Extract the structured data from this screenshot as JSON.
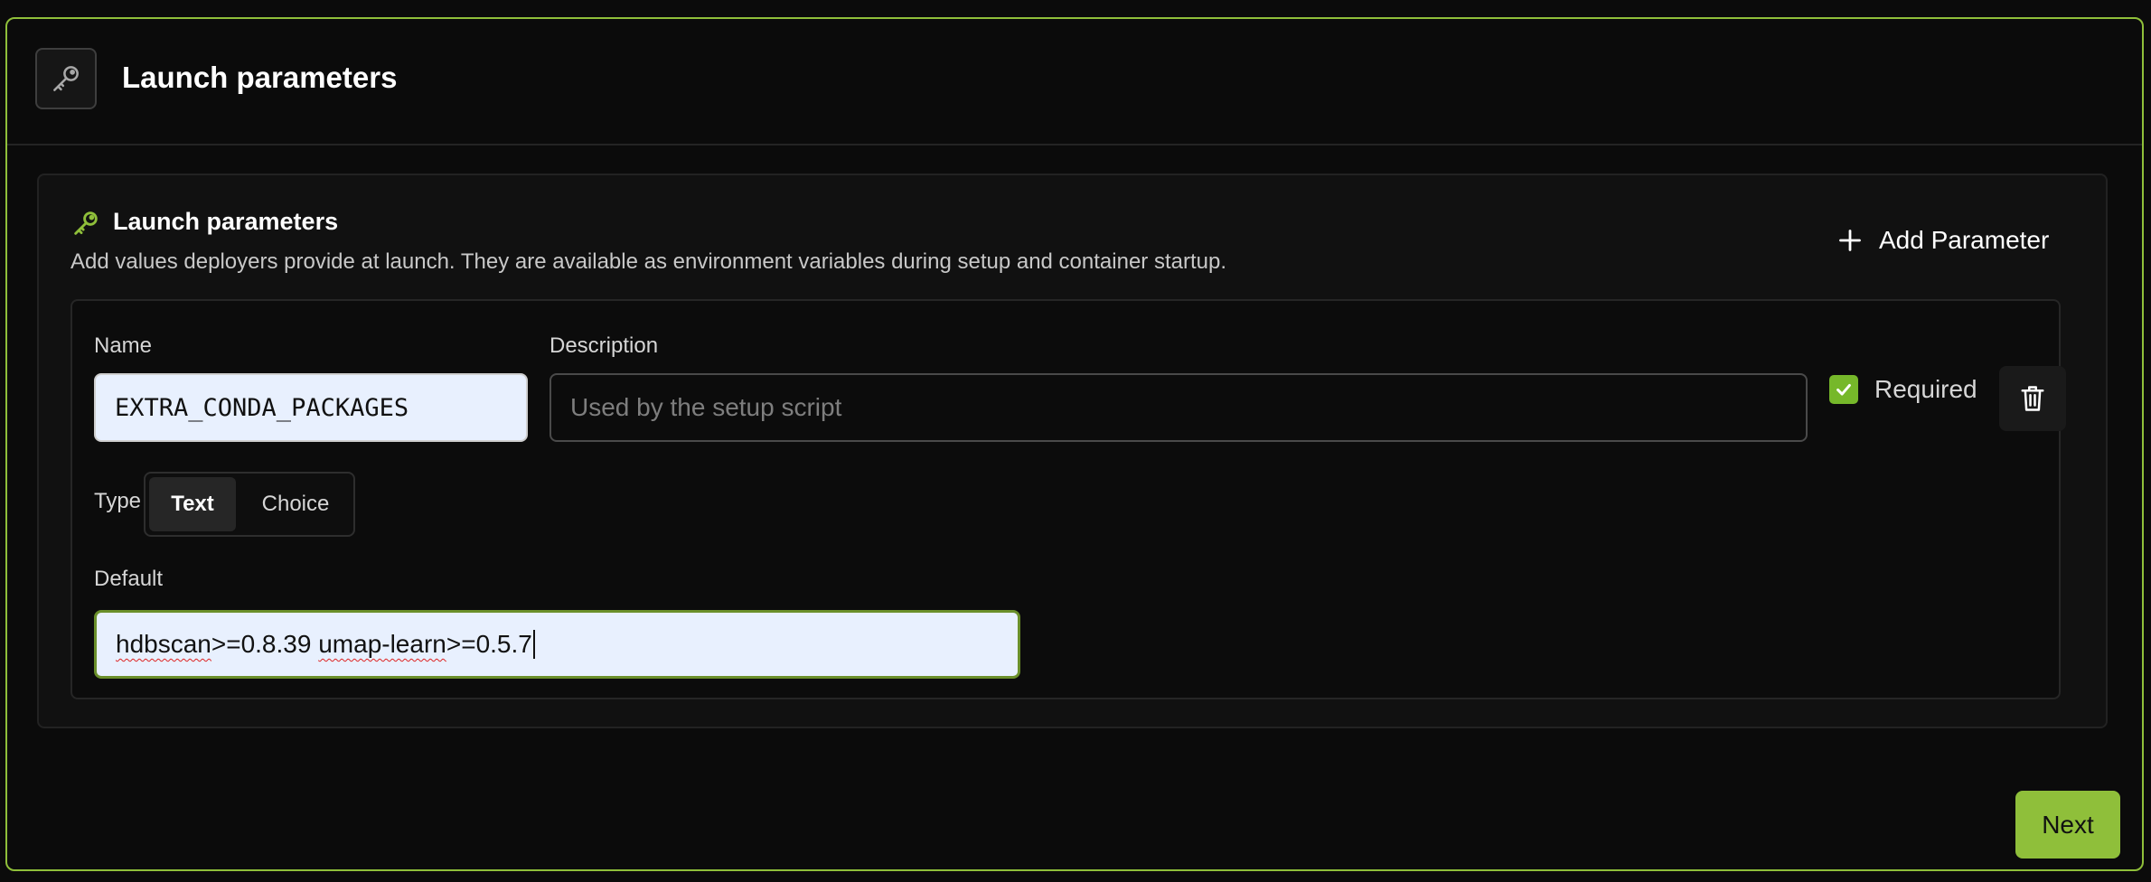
{
  "header": {
    "title": "Launch parameters",
    "icon": "key-icon"
  },
  "section": {
    "title": "Launch parameters",
    "description": "Add values deployers provide at launch. They are available as environment variables during setup and container startup.",
    "add_button_label": "Add Parameter"
  },
  "parameter": {
    "name_label": "Name",
    "name_value": "EXTRA_CONDA_PACKAGES",
    "description_label": "Description",
    "description_placeholder": "Used by the setup script",
    "description_value": "",
    "required_label": "Required",
    "required_checked": true,
    "type_label": "Type",
    "type_options": [
      "Text",
      "Choice"
    ],
    "type_selected": "Text",
    "default_label": "Default",
    "default_value_parts": [
      "hdbscan",
      ">=0.8.39 ",
      "umap-learn",
      ">=0.5.7"
    ]
  },
  "footer": {
    "next_label": "Next"
  },
  "colors": {
    "accent": "#76b82a",
    "border_accent": "#8fbf3a",
    "background": "#0b0b0b"
  }
}
